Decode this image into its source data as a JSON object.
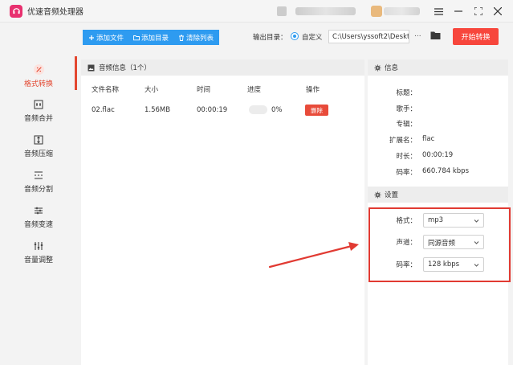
{
  "window": {
    "title": "优速音频处理器"
  },
  "toolbar": {
    "add_file": "添加文件",
    "add_folder": "添加目录",
    "clear_list": "清除列表",
    "output_label": "输出目录：",
    "custom_label": "自定义",
    "output_path": "C:\\Users\\yssoft2\\Deskt",
    "more": "...",
    "start_button": "开始转换"
  },
  "sidebar": {
    "items": [
      {
        "label": "格式转换",
        "icon": "format-convert-icon",
        "active": true
      },
      {
        "label": "音频合并",
        "icon": "audio-merge-icon"
      },
      {
        "label": "音频压缩",
        "icon": "audio-compress-icon"
      },
      {
        "label": "音频分割",
        "icon": "audio-split-icon"
      },
      {
        "label": "音频变速",
        "icon": "audio-speed-icon"
      },
      {
        "label": "音量调整",
        "icon": "volume-adjust-icon"
      }
    ]
  },
  "file_panel": {
    "title": "音频信息（1个）",
    "columns": [
      "文件名称",
      "大小",
      "时间",
      "进度",
      "操作"
    ],
    "rows": [
      {
        "name": "02.flac",
        "size": "1.56MB",
        "duration": "00:00:19",
        "progress": "0%",
        "progress_value": 0,
        "action": "删除"
      }
    ]
  },
  "info_panel": {
    "title": "信息",
    "fields": [
      {
        "label": "标题：",
        "value": ""
      },
      {
        "label": "歌手：",
        "value": ""
      },
      {
        "label": "专辑：",
        "value": ""
      },
      {
        "label": "扩展名：",
        "value": "flac"
      },
      {
        "label": "时长：",
        "value": "00:00:19"
      },
      {
        "label": "码率：",
        "value": "660.784 kbps"
      }
    ]
  },
  "settings_panel": {
    "title": "设置",
    "format_label": "格式：",
    "format_value": "mp3",
    "channel_label": "声道：",
    "channel_value": "同源音频",
    "bitrate_label": "码率：",
    "bitrate_value": "128 kbps"
  },
  "colors": {
    "accent_blue": "#2e9bf0",
    "start_red": "#f7463c",
    "active_red": "#e3462f",
    "highlight_red": "#e13a32"
  }
}
